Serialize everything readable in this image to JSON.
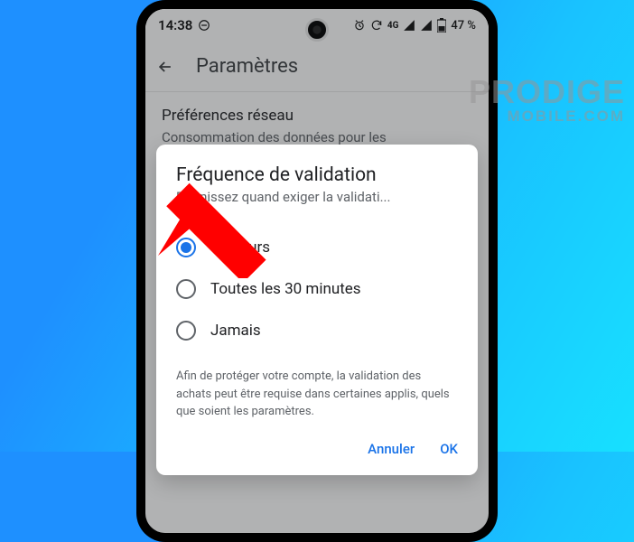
{
  "statusbar": {
    "time": "14:38",
    "battery": "47 %"
  },
  "appbar": {
    "title": "Paramètres"
  },
  "section": {
    "title": "Préférences réseau",
    "subtitle": "Consommation des données pour les téléchargements, mises à jour auto"
  },
  "dialog": {
    "title": "Fréquence de validation",
    "subtitle": "Définissez quand exiger la validati...",
    "options": [
      {
        "label": "Toujours",
        "selected": true
      },
      {
        "label": "Toutes les 30 minutes",
        "selected": false
      },
      {
        "label": "Jamais",
        "selected": false
      }
    ],
    "note": "Afin de protéger votre compte, la validation des achats peut être requise dans certaines applis, quels que soient les paramètres.",
    "cancel": "Annuler",
    "ok": "OK"
  },
  "watermark": {
    "line1": "PRODIGE",
    "line2": "MOBILE.COM"
  }
}
